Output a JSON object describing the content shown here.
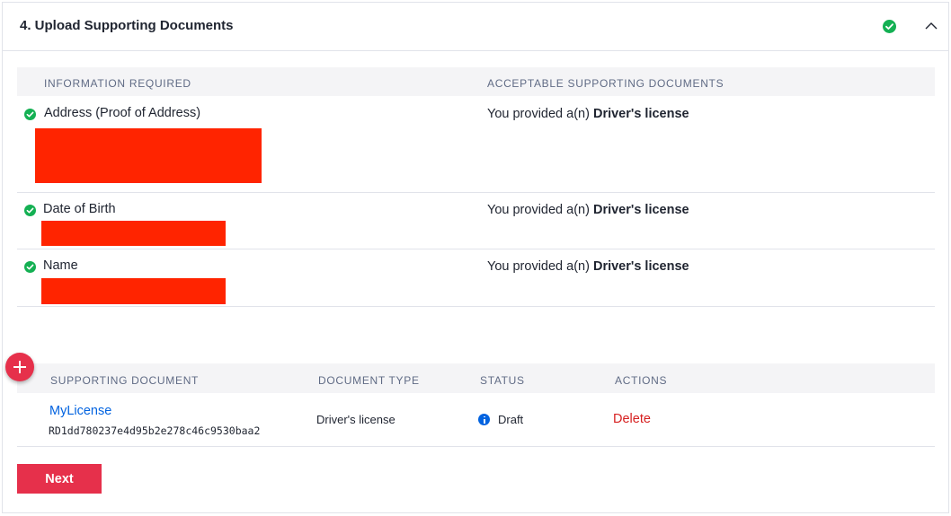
{
  "section": {
    "title": "4. Upload Supporting Documents",
    "complete": true
  },
  "requirements": {
    "headers": {
      "info": "INFORMATION REQUIRED",
      "docs": "ACCEPTABLE SUPPORTING DOCUMENTS"
    },
    "rows": [
      {
        "label": "Address (Proof of Address)",
        "provided_prefix": "You provided a(n) ",
        "provided_doc": "Driver's license"
      },
      {
        "label": "Date of Birth",
        "provided_prefix": "You provided a(n) ",
        "provided_doc": "Driver's license"
      },
      {
        "label": "Name",
        "provided_prefix": "You provided a(n) ",
        "provided_doc": "Driver's license"
      }
    ]
  },
  "documents": {
    "headers": {
      "doc": "SUPPORTING DOCUMENT",
      "type": "DOCUMENT TYPE",
      "status": "STATUS",
      "actions": "ACTIONS"
    },
    "rows": [
      {
        "name": "MyLicense",
        "sid": "RD1dd780237e4d95b2e278c46c9530baa2",
        "type": "Driver's license",
        "status": "Draft",
        "action": "Delete"
      }
    ]
  },
  "buttons": {
    "next": "Next"
  },
  "colors": {
    "accent": "#e6304b",
    "success": "#14b053",
    "link": "#0263e0",
    "redaction": "#ff2400"
  },
  "icons": {
    "complete": "check-circle-icon",
    "collapse": "chevron-up-icon",
    "add": "plus-circle-icon",
    "status": "info-icon"
  }
}
